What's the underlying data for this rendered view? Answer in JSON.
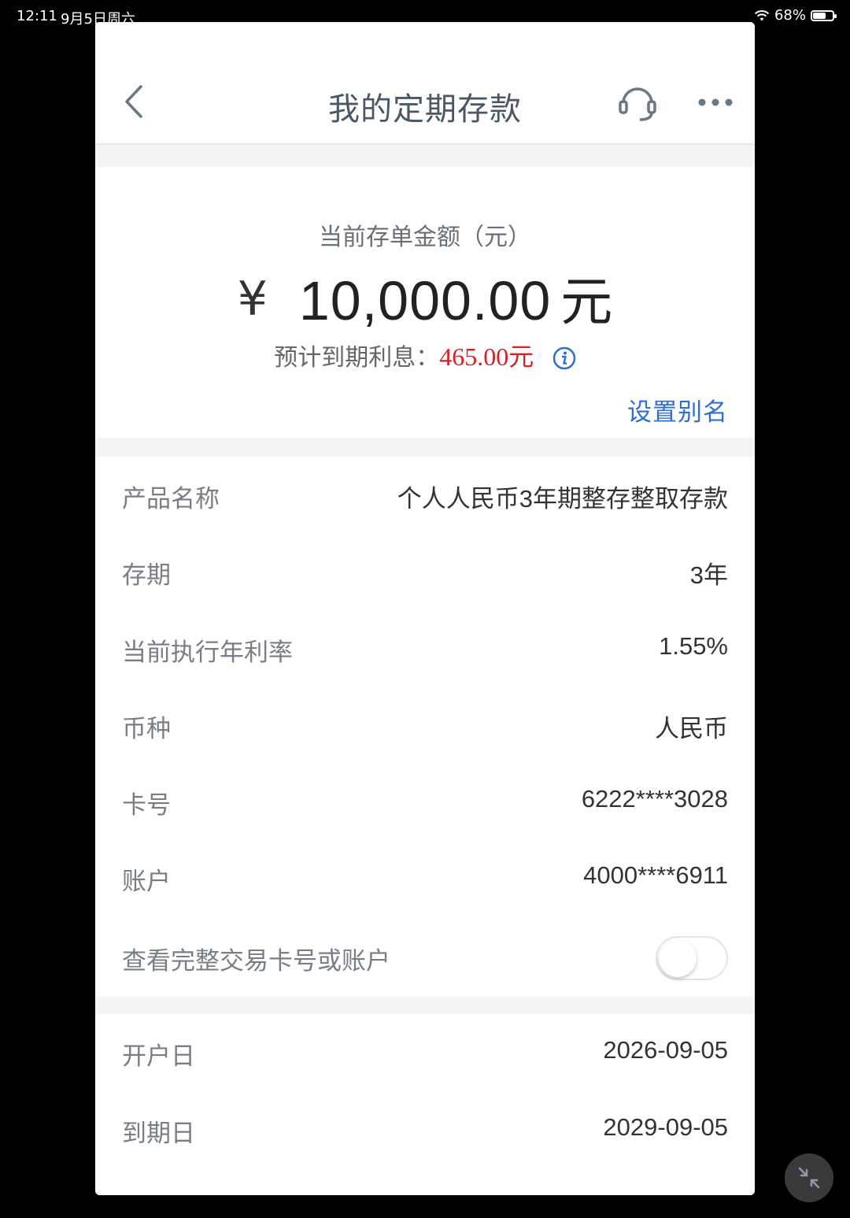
{
  "status_bar": {
    "time": "12:11",
    "date": "9月5日周六",
    "battery": "68%",
    "battery_level": 0.68
  },
  "nav": {
    "title": "我的定期存款",
    "icons": [
      "back-chevron-icon",
      "headset-icon",
      "more-dots-icon"
    ]
  },
  "summary": {
    "amount_label": "当前存单金额（元）",
    "currency_symbol": "¥",
    "amount": "10,000.00",
    "amount_unit": "元",
    "interest_label": "预计到期利息：",
    "interest_value": "465.00元",
    "alias_link": "设置别名"
  },
  "details": [
    {
      "label": "产品名称",
      "value": "个人人民币3年期整存整取存款"
    },
    {
      "label": "存期",
      "value": "3年"
    },
    {
      "label": "当前执行年利率",
      "value": "1.55%"
    },
    {
      "label": "币种",
      "value": "人民币"
    },
    {
      "label": "卡号",
      "value": "6222****3028"
    },
    {
      "label": "账户",
      "value": "4000****6911"
    }
  ],
  "toggle": {
    "label": "查看完整交易卡号或账户",
    "on": false
  },
  "dates": [
    {
      "label": "开户日",
      "value": "2026-09-05"
    },
    {
      "label": "到期日",
      "value": "2029-09-05"
    }
  ],
  "colors": {
    "accent_link": "#2f6fd0",
    "interest_red": "#d0242c",
    "title_gray": "#4a5866"
  }
}
